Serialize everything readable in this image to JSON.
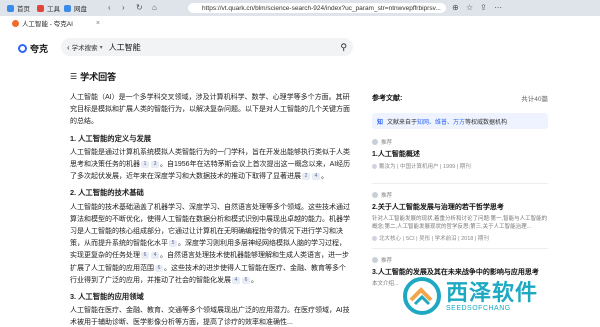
{
  "browser": {
    "bookmarks": [
      {
        "label": "首页",
        "color": "#3b8bea"
      },
      {
        "label": "工具",
        "color": "#e0453a"
      },
      {
        "label": "网盘",
        "color": "#3b8bea"
      }
    ],
    "tab": {
      "title": "人工智能 - 夸克AI"
    },
    "url": "https://vt.quark.cn/blm/science-search-924/index?uc_param_str=ntnwvepffrbiprsv..."
  },
  "app": {
    "logo": "夸克",
    "search": {
      "scope": "学术搜索",
      "query": "人工智能"
    }
  },
  "answer": {
    "title": "学术回答",
    "intro": "人工智能（AI）是一个多学科交叉领域，涉及计算机科学、数学、心理学等多个方面。其研究目标是模拟和扩展人类的智能行为，以解决复杂问题。以下是对人工智能的几个关键方面的总结。",
    "s1_title": "1. 人工智能的定义与发展",
    "s1_a": "人工智能是通过计算机系统模拟人类智能行为的一门学科，旨在开发出能够执行类似于人类思考和决策任务的机器",
    "s1_c1": "1",
    "s1_c2": "3",
    "s1_b": "。自1956年在达特茅斯会议上首次提出这一概念以来，AI经历了多次起伏发展，近年来在深度学习和大数据技术的推动下取得了显著进展",
    "s1_c3": "2",
    "s1_c4": "4",
    "s1_end": "。",
    "s2_title": "2. 人工智能的技术基础",
    "s2_a": "人工智能的技术基础涵盖了机器学习、深度学习、自然语言处理等多个领域。这些技术通过算法和模型的不断优化，使得人工智能在数据分析和模式识别中展现出卓越的能力。机器学习是人工智能的核心组成部分，它通过让计算机在无明确编程指令的情况下进行学习和决策，从而提升系统的智能化水平",
    "s2_c1": "5",
    "s2_b": "。深度学习则利用多层神经网络模拟人脑的学习过程，实现更复杂的任务处理",
    "s2_c2": "6",
    "s2_c3": "4",
    "s2_c": "。自然语言处理技术使机器能够理解和生成人类语言，进一步扩展了人工智能的应用范围",
    "s2_c4": "6",
    "s2_d": "。这些技术的进步使得人工智能在医疗、金融、教育等多个行业得到了广泛的应用，并推动了社会的智能化发展",
    "s2_c5": "4",
    "s2_c6": "6",
    "s2_end": "。",
    "s3_title": "3. 人工智能的应用领域",
    "s3_a": "人工智能在医疗、金融、教育、交通等多个领域展现出广泛的应用潜力。在医疗领域，AI技术被用于辅助诊断、医学影像分析等方面，提高了诊疗的效率和准确性..."
  },
  "refs": {
    "title": "参考文献:",
    "count": "共计40篇",
    "banner_prefix": "文献来自于",
    "banner_sources": "知网、维普、万方",
    "banner_suffix": "等权威数据机构",
    "cards": [
      {
        "tag": "推荐",
        "title": "1.人工智能概述",
        "desc": "",
        "source": "戴汝为 | 中国计算机用户 | 1999 | 期刊"
      },
      {
        "tag": "推荐",
        "title": "2.关于人工智能发展与治理的若干哲学思考",
        "desc": "针对人工智能发展的现状,着重分析和讨论了问题:第一,智能与人工智能的概念;第二,人工智能发展现状的哲学反思;第三,关于人工智能治理...",
        "source": "北大核心 | SCI | 吴彤 | 学术前沿 | 2018 | 期刊"
      },
      {
        "tag": "推荐",
        "title": "3.人工智能的发展及其在未来战争中的影响与应用思考",
        "desc": "本文介绍...",
        "source": ""
      }
    ]
  },
  "watermark": {
    "cn": "西泽软件",
    "en": "SEEDSOFCHANG"
  }
}
